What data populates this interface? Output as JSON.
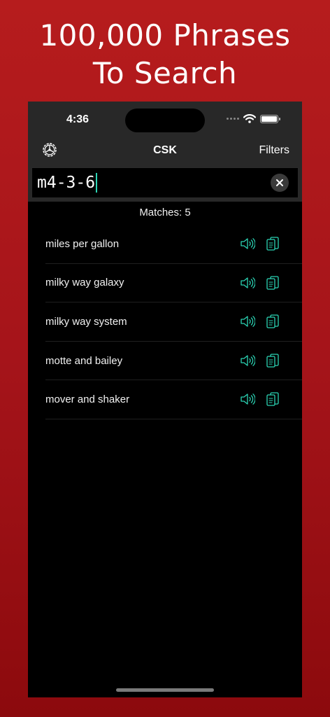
{
  "promo": {
    "line1": "100,000 Phrases",
    "line2": "To Search"
  },
  "status": {
    "time": "4:36",
    "icons": [
      "cellular-dots-icon",
      "wifi-icon",
      "battery-icon"
    ]
  },
  "navbar": {
    "title": "CSK",
    "filters_label": "Filters",
    "settings_icon": "gear-icon"
  },
  "search": {
    "value": "m4-3-6",
    "clear_icon": "clear-x-icon"
  },
  "matches_label": "Matches: 5",
  "results": [
    {
      "phrase": "miles per gallon"
    },
    {
      "phrase": "milky way galaxy"
    },
    {
      "phrase": "milky way system"
    },
    {
      "phrase": "motte and bailey"
    },
    {
      "phrase": "mover and shaker"
    }
  ],
  "colors": {
    "accent": "#2bd4b4",
    "promo_background": "#b61c1d",
    "navbar_background": "#282828",
    "list_background": "#000000"
  }
}
